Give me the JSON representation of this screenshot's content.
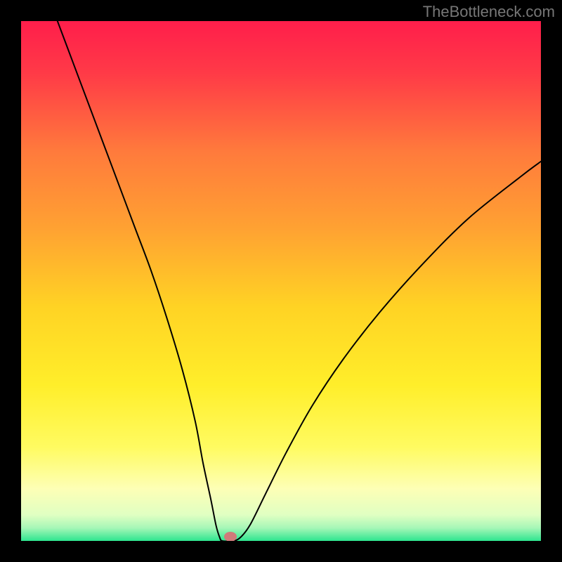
{
  "watermark": "TheBottleneck.com",
  "chart_data": {
    "type": "line",
    "title": "",
    "xlabel": "",
    "ylabel": "",
    "xlim": [
      0,
      100
    ],
    "ylim": [
      0,
      100
    ],
    "grid": false,
    "legend": false,
    "background_gradient_stops": [
      {
        "offset": 0.0,
        "color": "#ff1e4b"
      },
      {
        "offset": 0.1,
        "color": "#ff3a47"
      },
      {
        "offset": 0.25,
        "color": "#ff7a3c"
      },
      {
        "offset": 0.4,
        "color": "#ffa232"
      },
      {
        "offset": 0.55,
        "color": "#ffd324"
      },
      {
        "offset": 0.7,
        "color": "#ffee2a"
      },
      {
        "offset": 0.82,
        "color": "#fffb61"
      },
      {
        "offset": 0.9,
        "color": "#fdffb6"
      },
      {
        "offset": 0.95,
        "color": "#e0ffc2"
      },
      {
        "offset": 0.975,
        "color": "#a6f7b7"
      },
      {
        "offset": 1.0,
        "color": "#2de58f"
      }
    ],
    "series": [
      {
        "name": "bottleneck-curve",
        "color": "#000000",
        "width": 2,
        "x": [
          7,
          10,
          13,
          16,
          19,
          22,
          25,
          28,
          31,
          33.5,
          35,
          36.5,
          37.5,
          38.2,
          38.7,
          40.5,
          42,
          44,
          47,
          51,
          56,
          62,
          69,
          77,
          86,
          96,
          100
        ],
        "values": [
          100,
          92,
          84,
          76,
          68,
          60,
          52,
          43,
          33,
          23,
          15,
          8,
          3,
          0.7,
          0,
          0,
          0.5,
          3,
          9,
          17,
          26,
          35,
          44,
          53,
          62,
          70,
          73
        ]
      }
    ],
    "marker": {
      "x": 40.3,
      "y": 0.8,
      "color": "#d07a7a",
      "rx": 9,
      "ry": 7
    }
  }
}
